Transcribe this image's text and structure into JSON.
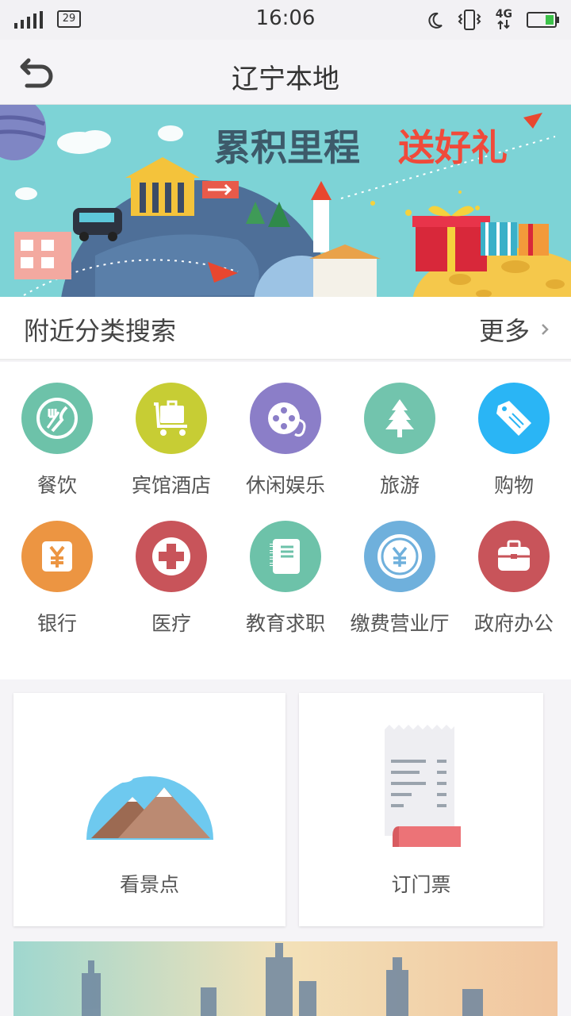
{
  "status_bar": {
    "badge": "29",
    "time": "16:06",
    "network": "4G"
  },
  "header": {
    "title": "辽宁本地"
  },
  "banner": {
    "headline_dark": "累积里程",
    "headline_accent": "送好礼"
  },
  "nearby": {
    "title": "附近分类搜索",
    "more_label": "更多"
  },
  "categories": [
    {
      "label": "餐饮",
      "icon": "dining-icon",
      "color": "#6dc2a9"
    },
    {
      "label": "宾馆酒店",
      "icon": "luggage-cart-icon",
      "color": "#c7cd34"
    },
    {
      "label": "休闲娱乐",
      "icon": "film-reel-icon",
      "color": "#8b7ec8"
    },
    {
      "label": "旅游",
      "icon": "tree-icon",
      "color": "#72c4ad"
    },
    {
      "label": "购物",
      "icon": "price-tag-icon",
      "color": "#2ab5f5"
    },
    {
      "label": "银行",
      "icon": "yen-bill-icon",
      "color": "#ec9542"
    },
    {
      "label": "医疗",
      "icon": "medical-cross-icon",
      "color": "#c8545a"
    },
    {
      "label": "教育求职",
      "icon": "notebook-icon",
      "color": "#6dc2a9"
    },
    {
      "label": "缴费营业厅",
      "icon": "yen-coin-icon",
      "color": "#6fb0dc"
    },
    {
      "label": "政府办公",
      "icon": "briefcase-icon",
      "color": "#c8545a"
    }
  ],
  "cards": [
    {
      "label": "看景点",
      "icon": "mountain-scenery-icon"
    },
    {
      "label": "订门票",
      "icon": "ticket-receipt-icon"
    }
  ]
}
